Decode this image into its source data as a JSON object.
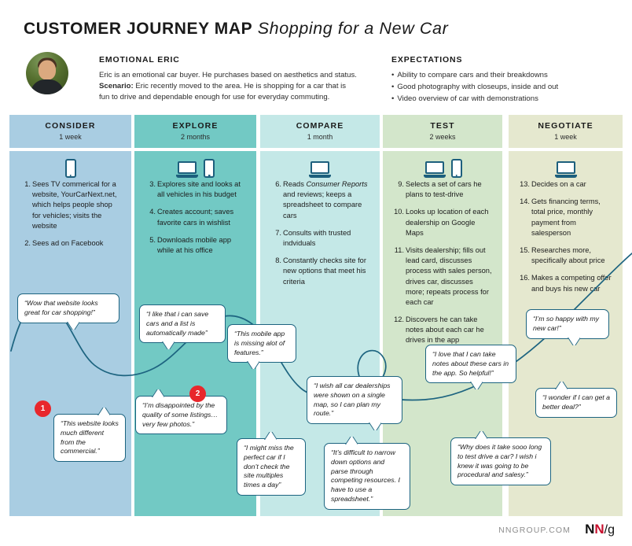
{
  "header": {
    "title_bold": "CUSTOMER JOURNEY MAP",
    "title_italic": "Shopping for a New Car",
    "persona": {
      "heading": "EMOTIONAL ERIC",
      "line1": "Eric is an emotional car buyer. He purchases based on aesthetics and status.",
      "scenario_label": "Scenario:",
      "scenario_text": " Eric recently moved to the area. He is shopping for a car that is fun to drive and dependable enough for use for everyday commuting."
    },
    "expectations": {
      "heading": "EXPECTATIONS",
      "items": [
        "Ability to compare cars and their breakdowns",
        "Good photography with closeups, inside and out",
        "Video overview of car with demonstrations"
      ]
    }
  },
  "columns": [
    {
      "name": "CONSIDER",
      "duration": "1 week",
      "color": "#a9cde2",
      "devices": [
        "phone"
      ],
      "steps": [
        {
          "num": "1.",
          "text": "Sees TV commerical for a website, YourCarNext.net, which helps people shop for vehicles; visits the website"
        },
        {
          "num": "2.",
          "text": "Sees ad on Facebook"
        }
      ]
    },
    {
      "name": "EXPLORE",
      "duration": "2 months",
      "color": "#72c9c4",
      "devices": [
        "laptop",
        "phone"
      ],
      "steps": [
        {
          "num": "3.",
          "text": "Explores site and looks at all vehicles in his budget"
        },
        {
          "num": "4.",
          "text": "Creates account; saves favorite cars in wishlist"
        },
        {
          "num": "5.",
          "text": "Downloads mobile app while at his office"
        }
      ]
    },
    {
      "name": "COMPARE",
      "duration": "1 month",
      "color": "#c4e8e7",
      "devices": [
        "laptop"
      ],
      "steps": [
        {
          "num": "6.",
          "text": "Reads Consumer Reports and reviews; keeps a spreadsheet to compare cars",
          "italic_part": "Consumer Reports"
        },
        {
          "num": "7.",
          "text": "Consults with trusted indviduals"
        },
        {
          "num": "8.",
          "text": "Constantly checks site for new options that meet his criteria"
        }
      ]
    },
    {
      "name": "TEST",
      "duration": "2 weeks",
      "color": "#d3e6cb",
      "devices": [
        "laptop",
        "phone"
      ],
      "steps": [
        {
          "num": "9.",
          "text": "Selects a set of cars he plans to test-drive"
        },
        {
          "num": "10.",
          "text": "Looks up location of each dealership on Google Maps"
        },
        {
          "num": "11.",
          "text": "Visits dealership; fills out lead card, discusses process with sales person, drives car, discusses more; repeats process for each car"
        },
        {
          "num": "12.",
          "text": "Discovers he can take notes about each car he drives in the app"
        }
      ]
    },
    {
      "name": "NEGOTIATE",
      "duration": "1 week",
      "color": "#e5e8cf",
      "devices": [
        "laptop"
      ],
      "steps": [
        {
          "num": "13.",
          "text": "Decides on a car"
        },
        {
          "num": "14.",
          "text": "Gets financing terms, total price, monthly payment from salesperson"
        },
        {
          "num": "15.",
          "text": "Researches more, specifically about price"
        },
        {
          "num": "16.",
          "text": "Makes a competing offer and buys his new car"
        }
      ]
    }
  ],
  "quotes": [
    {
      "id": "q1",
      "text": "“Wow that website looks great for car shopping!”"
    },
    {
      "id": "q2",
      "text": "“This website looks much different from the commercial.”",
      "marker": "1"
    },
    {
      "id": "q3",
      "text": "“I like that i can save cars and a list is automatically made”"
    },
    {
      "id": "q4",
      "text": "“This mobile app is missing alot of features.”"
    },
    {
      "id": "q5",
      "text": "“I’m disappointed by the quality of some listings… very few photos.”",
      "marker": "2"
    },
    {
      "id": "q6",
      "text": "“I might miss the perfect car if I don’t check the site multiples times a day”"
    },
    {
      "id": "q7",
      "text": "“I wish all car dealerships were shown on a single map, so I can plan my route.”"
    },
    {
      "id": "q8",
      "text": "“It’s difficult to narrow down options and parse through competing resources. I have to use a spreadsheet.”"
    },
    {
      "id": "q9",
      "text": "“I love that I can take notes about these cars in the app. So helpful!”"
    },
    {
      "id": "q10",
      "text": "“Why does it take sooo long to test drive a car? I wish i knew it was going to be procedural and salesy.”"
    },
    {
      "id": "q11",
      "text": "“I’m so happy with my new car!”"
    },
    {
      "id": "q12",
      "text": "“I wonder if I can get a better deal?”"
    }
  ],
  "markers": {
    "m1": "1",
    "m2": "2"
  },
  "footer": {
    "site": "NNGROUP.COM",
    "logo_n": "N",
    "logo_n2": "N",
    "logo_slash": "/g"
  },
  "colors": {
    "curve": "#1d6480",
    "marker": "#e8272c",
    "bubble_border": "#1d6480"
  }
}
